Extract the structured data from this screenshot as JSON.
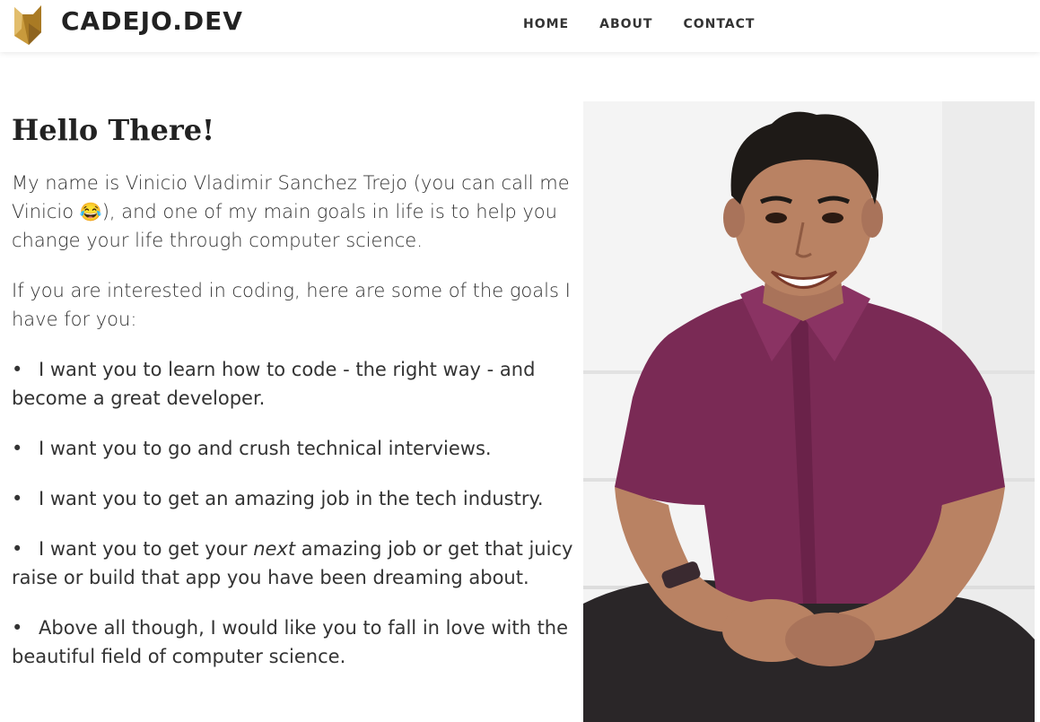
{
  "header": {
    "brand": "CADEJO.DEV",
    "nav": [
      "HOME",
      "ABOUT",
      "CONTACT"
    ]
  },
  "main": {
    "heading": "Hello There!",
    "intro_before_emoji": "My name is Vinicio Vladimir Sanchez Trejo (you can call me Vinicio ",
    "emoji": "😂",
    "intro_after_emoji": "), and one of my main goals in life is to help you change your life through computer science.",
    "goals_intro": "If you are interested in coding, here are some of the goals I have for you:",
    "goals": [
      "I want you to learn how to code - the right way - and become a great developer.",
      "I want you to go and crush technical interviews.",
      "I want you to get an amazing job in the tech industry.",
      {
        "before": "I want you to get your ",
        "emphasis": "next",
        "after": " amazing job or get that juicy raise or build that app you have been dreaming about."
      },
      "Above all though, I would like you to fall in love with the beautiful field of computer science."
    ]
  },
  "colors": {
    "shirt": "#7a2a55",
    "skin": "#b98263",
    "hair": "#1e1a17",
    "pants": "#2a2628",
    "logo_gold": "#c99a3c"
  }
}
